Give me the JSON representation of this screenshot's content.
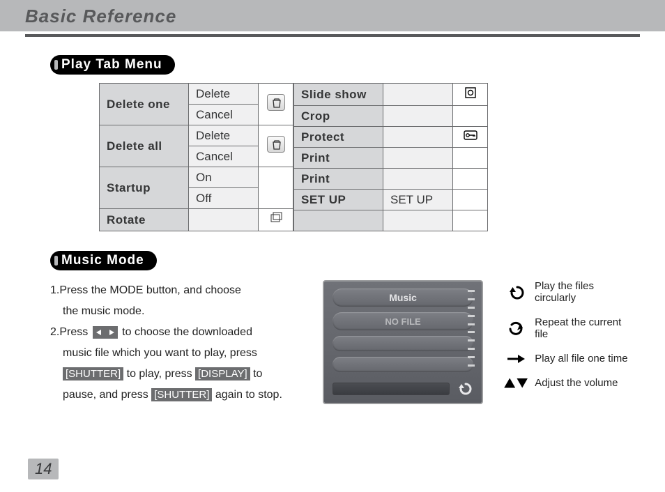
{
  "header": {
    "title": "Basic Reference"
  },
  "section1": {
    "title": "Play Tab Menu"
  },
  "menu_left": {
    "r1": {
      "label": "Delete one",
      "a": "Delete",
      "b": "Cancel"
    },
    "r2": {
      "label": "Delete all",
      "a": "Delete",
      "b": "Cancel"
    },
    "r3": {
      "label": "Startup",
      "a": "On",
      "b": "Off"
    },
    "r4": {
      "label": "Rotate"
    }
  },
  "menu_right": {
    "r1": {
      "label": "Slide show"
    },
    "r2": {
      "label": "Crop"
    },
    "r3": {
      "label": "Protect"
    },
    "r4": {
      "label": "Print"
    },
    "r5": {
      "label": "Print"
    },
    "r6": {
      "label": "SET UP",
      "val": "SET UP"
    }
  },
  "section2": {
    "title": "Music Mode"
  },
  "steps": {
    "s1a": "1.Press the MODE button, and choose",
    "s1b": "the music mode.",
    "s2a": "2.Press",
    "s2b": " to choose the downloaded",
    "s2c": "music file which you want to play, press",
    "s2d1": "[SHUTTER]",
    "s2d2": " to play, press",
    "s2d3": "[DISPLAY]",
    "s2d4": " to",
    "s2e1": "pause, and press",
    "s2e2": "[SHUTTER]",
    "s2e3": " again to stop."
  },
  "screen": {
    "title": "Music",
    "empty": "NO FILE"
  },
  "legend": {
    "l1": "Play the files circularly",
    "l2": "Repeat the current file",
    "l3": "Play all file one time",
    "l4": "Adjust the volume"
  },
  "page": "14"
}
